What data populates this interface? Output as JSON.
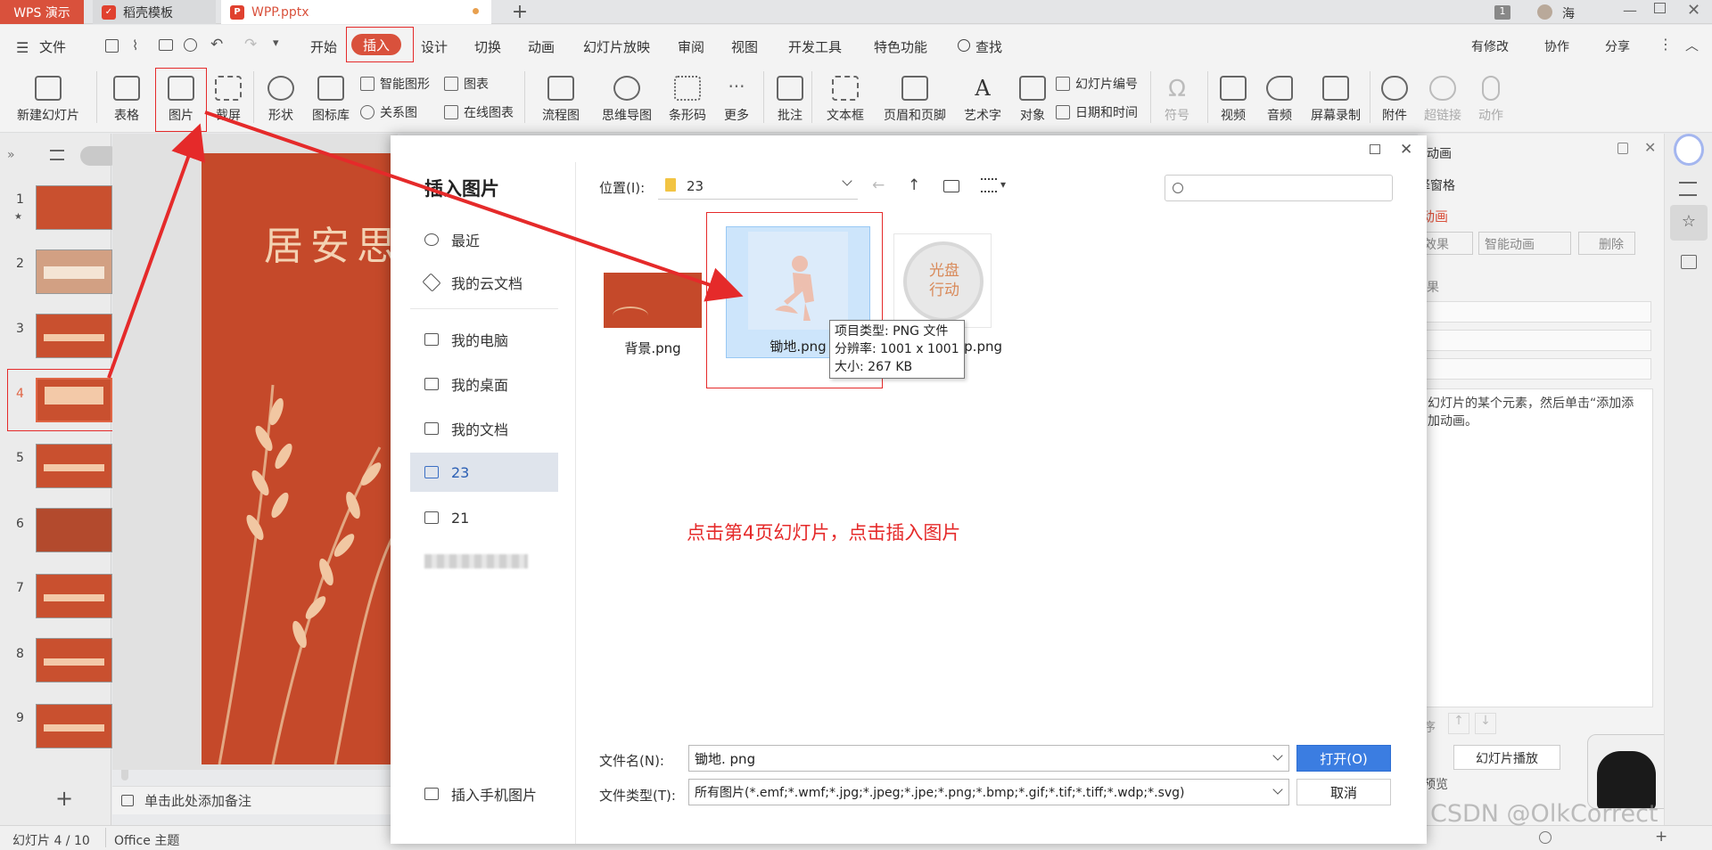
{
  "tabs": [
    {
      "label": "WPS 演示"
    },
    {
      "label": "稻壳模板"
    },
    {
      "label": "WPP.pptx"
    }
  ],
  "titlebar": {
    "page_badge": "1",
    "user": "海"
  },
  "menu": {
    "file": "文件",
    "items": [
      "开始",
      "插入",
      "设计",
      "切换",
      "动画",
      "幻灯片放映",
      "审阅",
      "视图",
      "开发工具",
      "特色功能"
    ],
    "search": "查找",
    "right": [
      "有修改",
      "协作",
      "分享"
    ]
  },
  "ribbon": {
    "new_slide": "新建幻灯片",
    "table": "表格",
    "picture": "图片",
    "screenshot": "截屏",
    "shape": "形状",
    "icon_lib": "图标库",
    "smart_shape": "智能图形",
    "chart": "图表",
    "relation": "关系图",
    "online_chart": "在线图表",
    "flowchart": "流程图",
    "mindmap": "思维导图",
    "barcode": "条形码",
    "more": "更多",
    "comment": "批注",
    "textbox": "文本框",
    "header_footer": "页眉和页脚",
    "wordart": "艺术字",
    "object": "对象",
    "slide_number": "幻灯片编号",
    "datetime": "日期和时间",
    "symbol": "符号",
    "video": "视频",
    "audio": "音频",
    "screen_record": "屏幕录制",
    "attachment": "附件",
    "hyperlink": "超链接",
    "action": "动作"
  },
  "slides": [
    "1",
    "2",
    "3",
    "4",
    "5",
    "6",
    "7",
    "8",
    "9"
  ],
  "slide": {
    "title": "居安思"
  },
  "notes": "单击此处添加备注",
  "status": {
    "slide_pos": "幻灯片 4 / 10",
    "theme": "Office 主题"
  },
  "dialog": {
    "title": "插入图片",
    "location_label": "位置(I):",
    "location_value": "23",
    "nav": [
      "最近",
      "我的云文档",
      "我的电脑",
      "我的桌面",
      "我的文档",
      "23",
      "21"
    ],
    "mobile": "插入手机图片",
    "files": [
      "背景.png",
      "锄地.png",
      "p.png"
    ],
    "disc_text": "光盘行动",
    "tooltip": [
      "项目类型: PNG 文件",
      "分辨率: 1001 x 1001",
      "大小: 267 KB"
    ],
    "instruction": "点击第4页幻灯片，点击插入图片",
    "filename_label": "文件名(N):",
    "filename_value": "锄地. png",
    "filetype_label": "文件类型(T):",
    "filetype_value": "所有图片(*.emf;*.wmf;*.jpg;*.jpeg;*.jpe;*.png;*.bmp;*.gif;*.tif;*.tiff;*.wdp;*.svg)",
    "open": "打开(O)",
    "cancel": "取消"
  },
  "rightpanel": {
    "title": "动画",
    "pane": "择窗格",
    "anim": "动画",
    "effect": "效果",
    "smart_anim": "智能动画",
    "delete": "删除",
    "result": "果",
    "hint": "幻灯片的某个元素，然后单击“添加添加动画。",
    "reorder": "序",
    "play": "幻灯片播放",
    "preview": "预览"
  },
  "watermark": "CSDN @OlkCorrect",
  "colors": {
    "accent": "#d9513c",
    "highlight_box": "#e52a2a",
    "slide_bg": "#c5492a",
    "open_btn": "#3b7de1"
  }
}
